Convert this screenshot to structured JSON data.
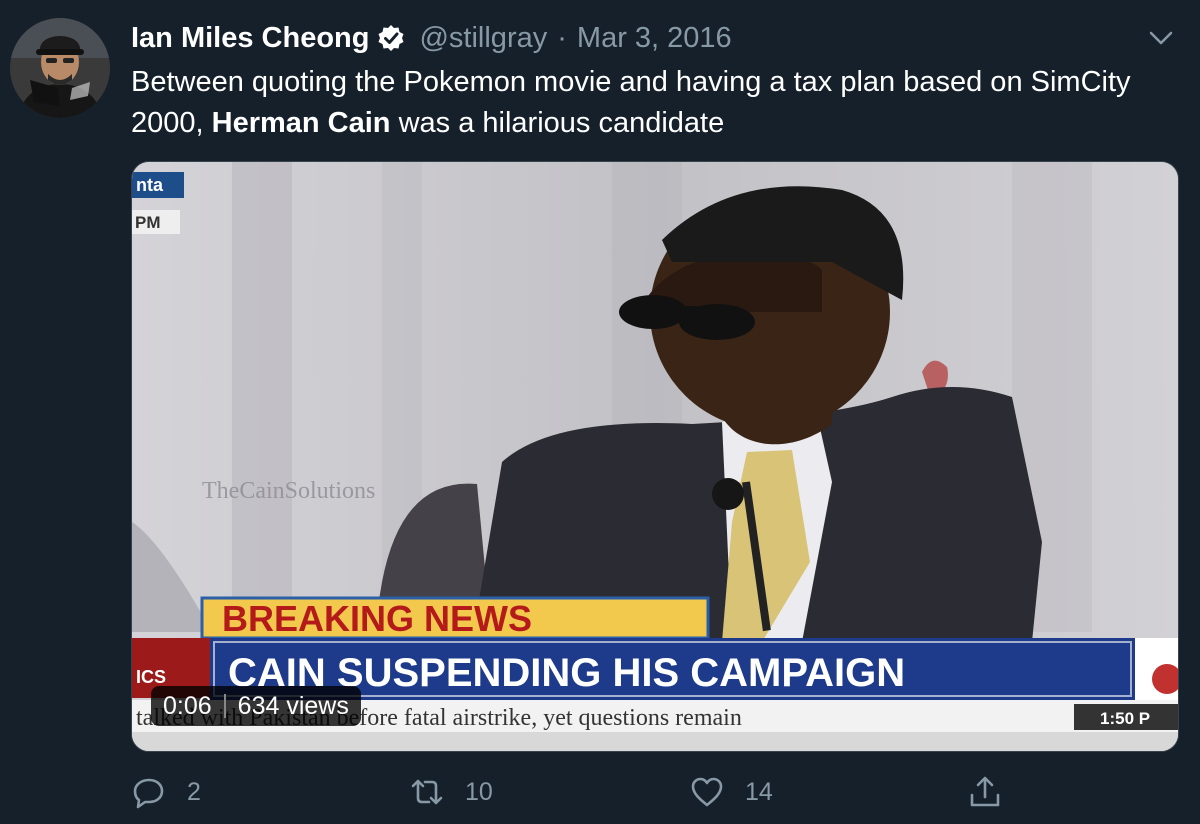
{
  "tweet": {
    "display_name": "Ian Miles Cheong",
    "handle": "@stillgray",
    "separator": "·",
    "date": "Mar 3, 2016",
    "text_part1": "Between quoting the Pokemon movie and having a tax plan based on SimCity 2000, ",
    "text_bold": "Herman Cain",
    "text_part2": " was a hilarious candidate"
  },
  "media": {
    "banner_breaking": "BREAKING NEWS",
    "banner_headline": "CAIN SUSPENDING HIS CAMPAIGN",
    "ticker_text": "talked with Pakistan before fatal airstrike, yet questions remain",
    "ticker_time": "1:50 P",
    "corner_label_top": "nta",
    "corner_label_bottom": "PM",
    "network_label": "ICS",
    "backdrop_text": "TheCainSolutions",
    "duration": "0:06",
    "views": "634 views"
  },
  "actions": {
    "reply_count": "2",
    "retweet_count": "10",
    "like_count": "14"
  },
  "icons": {
    "verified": "verified-badge-icon",
    "caret": "chevron-down-icon",
    "reply": "reply-icon",
    "retweet": "retweet-icon",
    "like": "heart-icon",
    "share": "share-icon"
  },
  "colors": {
    "background": "#15202b",
    "muted": "#8899a6",
    "verified_badge": "#ffffff",
    "breaking_bg": "#f2c94c",
    "headline_bg": "#1e3a8a"
  }
}
